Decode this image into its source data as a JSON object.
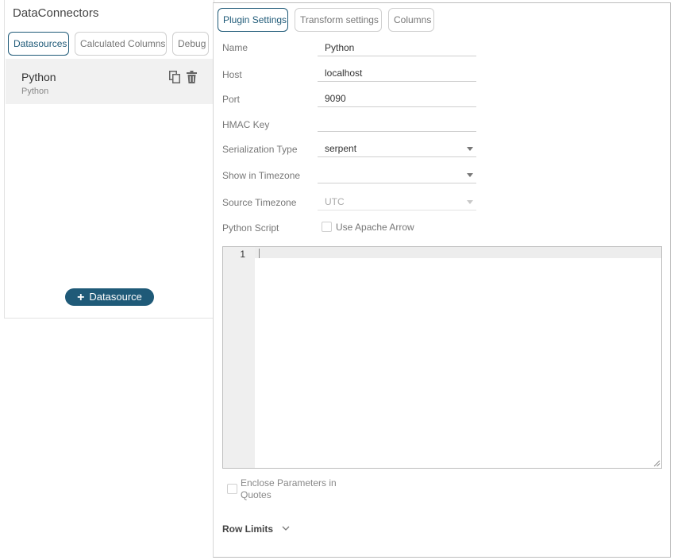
{
  "left_panel": {
    "title": "DataConnectors",
    "tabs": [
      "Datasources",
      "Calculated Columns",
      "Debug"
    ],
    "active_tab": "Datasources",
    "datasources": [
      {
        "name": "Python",
        "type": "Python",
        "icons": [
          "copy-icon",
          "trash-icon"
        ]
      }
    ],
    "add_button_label": "Datasource",
    "add_button_icon": "plus-icon"
  },
  "right_panel": {
    "tabs": [
      "Plugin Settings",
      "Transform settings",
      "Columns"
    ],
    "active_tab": "Plugin Settings",
    "form": {
      "name": {
        "label": "Name",
        "value": "Python"
      },
      "host": {
        "label": "Host",
        "value": "localhost"
      },
      "port": {
        "label": "Port",
        "value": "9090"
      },
      "hmac_key": {
        "label": "HMAC Key",
        "value": ""
      },
      "serialization_type": {
        "label": "Serialization Type",
        "value": "serpent"
      },
      "show_in_timezone": {
        "label": "Show in Timezone",
        "value": ""
      },
      "source_timezone": {
        "label": "Source Timezone",
        "value": "UTC",
        "disabled": true
      },
      "python_script": {
        "label": "Python Script",
        "checkbox_label": "Use Apache Arrow",
        "checked": false
      }
    },
    "editor": {
      "line_numbers": [
        "1"
      ],
      "content": ""
    },
    "enclose_parameters": {
      "label": "Enclose Parameters in Quotes",
      "checked": false,
      "disabled": true
    },
    "row_limits": {
      "label": "Row Limits",
      "icon": "chevron-down-icon"
    }
  },
  "colors": {
    "accent": "#1f5a78",
    "selected_item_bg": "#f1f1f1",
    "border": "#cfcfcf",
    "label_text": "#777777"
  }
}
